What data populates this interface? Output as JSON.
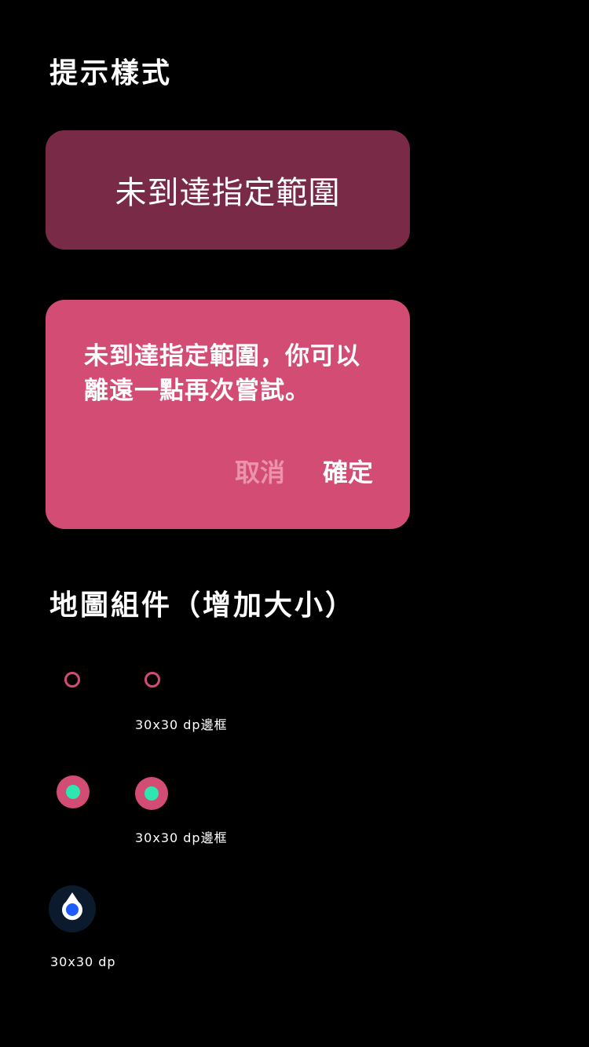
{
  "sections": {
    "prompt_title": "提示樣式",
    "map_title": "地圖組件（增加大小）"
  },
  "toast": {
    "text": "未到達指定範圍"
  },
  "dialog": {
    "message": "未到達指定範圍，你可以離遠一點再次嘗試。",
    "cancel_label": "取消",
    "confirm_label": "確定"
  },
  "map_components": {
    "ring_caption": "30x30 dp邊框",
    "dot_caption": "30x30 dp邊框",
    "location_caption": "30x30 dp"
  },
  "colors": {
    "accent": "#d24c74",
    "toast_bg": "#782a46",
    "dot_center": "#2ee6b0",
    "location_bg": "#0c1a2e",
    "location_blue": "#1f5cff"
  },
  "icons": {
    "ring": "ring-marker-icon",
    "dot": "dot-marker-icon",
    "location": "location-marker-icon"
  }
}
